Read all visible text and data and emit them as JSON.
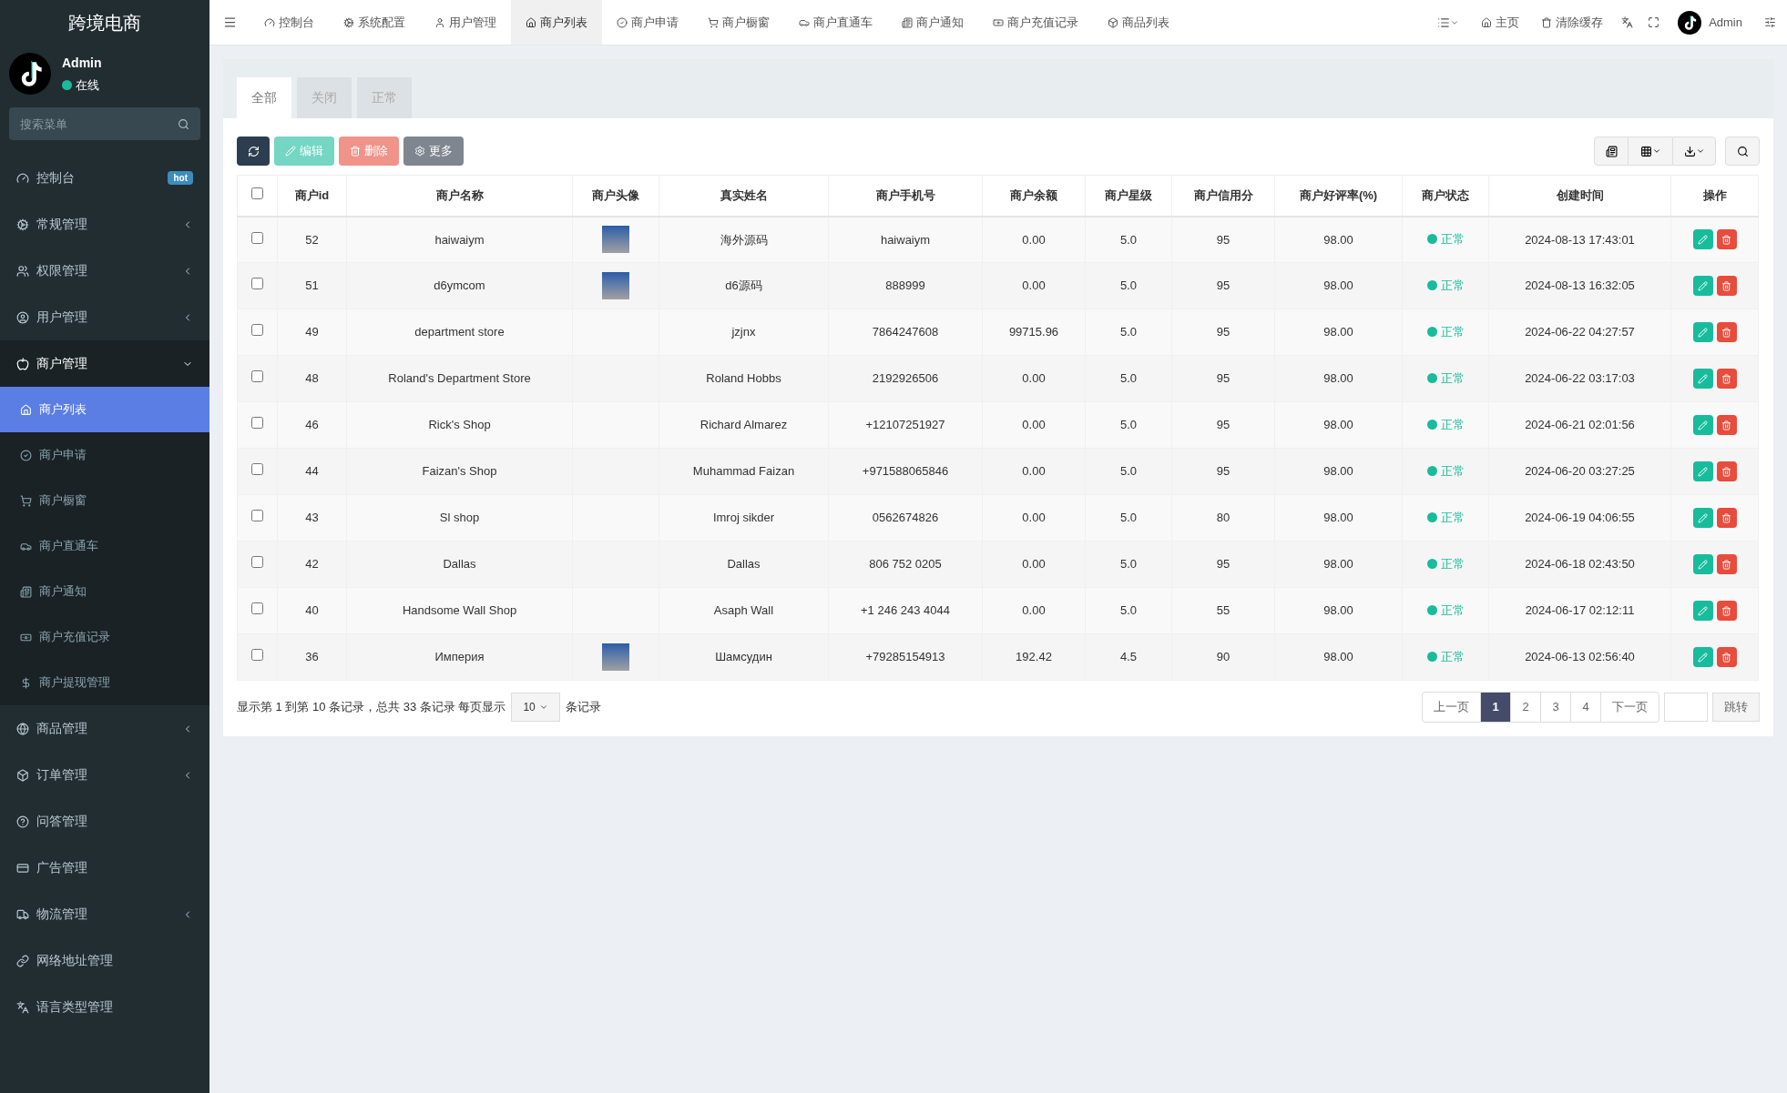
{
  "app_title": "跨境电商",
  "user": {
    "name": "Admin",
    "status": "在线"
  },
  "search": {
    "placeholder": "搜索菜单"
  },
  "sidebar": {
    "items": [
      {
        "label": "控制台",
        "badge": "hot",
        "expandable": false
      },
      {
        "label": "常规管理",
        "expandable": true,
        "expanded": false
      },
      {
        "label": "权限管理",
        "expandable": true,
        "expanded": false
      },
      {
        "label": "用户管理",
        "expandable": true,
        "expanded": false
      },
      {
        "label": "商户管理",
        "expandable": true,
        "expanded": true,
        "children": [
          {
            "label": "商户列表",
            "selected": true
          },
          {
            "label": "商户申请",
            "selected": false
          },
          {
            "label": "商户橱窗",
            "selected": false
          },
          {
            "label": "商户直通车",
            "selected": false
          },
          {
            "label": "商户通知",
            "selected": false
          },
          {
            "label": "商户充值记录",
            "selected": false
          },
          {
            "label": "商户提现管理",
            "selected": false
          }
        ]
      },
      {
        "label": "商品管理",
        "expandable": true,
        "expanded": false
      },
      {
        "label": "订单管理",
        "expandable": true,
        "expanded": false
      },
      {
        "label": "问答管理",
        "expandable": false
      },
      {
        "label": "广告管理",
        "expandable": false
      },
      {
        "label": "物流管理",
        "expandable": true,
        "expanded": false
      },
      {
        "label": "网络地址管理",
        "expandable": false
      },
      {
        "label": "语言类型管理",
        "expandable": false
      }
    ]
  },
  "top_tabs": [
    {
      "label": "控制台",
      "selected": false
    },
    {
      "label": "系统配置",
      "selected": false
    },
    {
      "label": "用户管理",
      "selected": false
    },
    {
      "label": "商户列表",
      "selected": true
    },
    {
      "label": "商户申请",
      "selected": false
    },
    {
      "label": "商户橱窗",
      "selected": false
    },
    {
      "label": "商户直通车",
      "selected": false
    },
    {
      "label": "商户通知",
      "selected": false
    },
    {
      "label": "商户充值记录",
      "selected": false
    },
    {
      "label": "商品列表",
      "selected": false
    }
  ],
  "top_right": {
    "home": "主页",
    "clear_cache": "清除缓存",
    "admin": "Admin"
  },
  "filter_tabs": [
    {
      "label": "全部",
      "selected": true
    },
    {
      "label": "关闭",
      "selected": false
    },
    {
      "label": "正常",
      "selected": false
    }
  ],
  "toolbar": {
    "edit": {
      "label": "编辑",
      "disabled": true
    },
    "delete": {
      "label": "删除",
      "disabled": true
    },
    "more": {
      "label": "更多",
      "disabled": true
    }
  },
  "table": {
    "select_all_checked": false,
    "columns": [
      "商户id",
      "商户名称",
      "商户头像",
      "真实姓名",
      "商户手机号",
      "商户余额",
      "商户星级",
      "商户信用分",
      "商户好评率(%)",
      "商户状态",
      "创建时间",
      "操作"
    ],
    "rows": [
      {
        "checked": false,
        "id": "52",
        "name": "haiwaiym",
        "avatar": true,
        "real_name": "海外源码",
        "phone": "haiwaiym",
        "balance": "0.00",
        "star": "5.0",
        "credit": "95",
        "rating": "98.00",
        "status": "正常",
        "created": "2024-08-13 17:43:01"
      },
      {
        "checked": false,
        "id": "51",
        "name": "d6ymcom",
        "avatar": true,
        "real_name": "d6源码",
        "phone": "888999",
        "balance": "0.00",
        "star": "5.0",
        "credit": "95",
        "rating": "98.00",
        "status": "正常",
        "created": "2024-08-13 16:32:05"
      },
      {
        "checked": false,
        "id": "49",
        "name": "department store",
        "avatar": false,
        "real_name": "jzjnx",
        "phone": "7864247608",
        "balance": "99715.96",
        "star": "5.0",
        "credit": "95",
        "rating": "98.00",
        "status": "正常",
        "created": "2024-06-22 04:27:57"
      },
      {
        "checked": false,
        "id": "48",
        "name": "Roland's Department Store",
        "avatar": false,
        "real_name": "Roland Hobbs",
        "phone": "2192926506",
        "balance": "0.00",
        "star": "5.0",
        "credit": "95",
        "rating": "98.00",
        "status": "正常",
        "created": "2024-06-22 03:17:03"
      },
      {
        "checked": false,
        "id": "46",
        "name": "Rick's Shop",
        "avatar": false,
        "real_name": "Richard Almarez",
        "phone": "+12107251927",
        "balance": "0.00",
        "star": "5.0",
        "credit": "95",
        "rating": "98.00",
        "status": "正常",
        "created": "2024-06-21 02:01:56"
      },
      {
        "checked": false,
        "id": "44",
        "name": "Faizan's Shop",
        "avatar": false,
        "real_name": "Muhammad Faizan",
        "phone": "+971588065846",
        "balance": "0.00",
        "star": "5.0",
        "credit": "95",
        "rating": "98.00",
        "status": "正常",
        "created": "2024-06-20 03:27:25"
      },
      {
        "checked": false,
        "id": "43",
        "name": "Sl shop",
        "avatar": false,
        "real_name": "Imroj sikder",
        "phone": "0562674826",
        "balance": "0.00",
        "star": "5.0",
        "credit": "80",
        "rating": "98.00",
        "status": "正常",
        "created": "2024-06-19 04:06:55"
      },
      {
        "checked": false,
        "id": "42",
        "name": "Dallas",
        "avatar": false,
        "real_name": "Dallas",
        "phone": "806 752 0205",
        "balance": "0.00",
        "star": "5.0",
        "credit": "95",
        "rating": "98.00",
        "status": "正常",
        "created": "2024-06-18 02:43:50"
      },
      {
        "checked": false,
        "id": "40",
        "name": "Handsome Wall Shop",
        "avatar": false,
        "real_name": "Asaph Wall",
        "phone": "+1 246 243 4044",
        "balance": "0.00",
        "star": "5.0",
        "credit": "55",
        "rating": "98.00",
        "status": "正常",
        "created": "2024-06-17 02:12:11"
      },
      {
        "checked": false,
        "id": "36",
        "name": "Империя",
        "avatar": true,
        "real_name": "Шамсудин",
        "phone": "+79285154913",
        "balance": "192.42",
        "star": "4.5",
        "credit": "90",
        "rating": "98.00",
        "status": "正常",
        "created": "2024-06-13 02:56:40"
      }
    ]
  },
  "pagination": {
    "summary": "显示第 1 到第 10 条记录，总共 33 条记录 每页显示",
    "page_size": "10",
    "suffix": "条记录",
    "prev": "上一页",
    "next": "下一页",
    "jump": "跳转",
    "pages": [
      {
        "label": "1",
        "selected": true
      },
      {
        "label": "2",
        "selected": false
      },
      {
        "label": "3",
        "selected": false
      },
      {
        "label": "4",
        "selected": false
      }
    ]
  }
}
